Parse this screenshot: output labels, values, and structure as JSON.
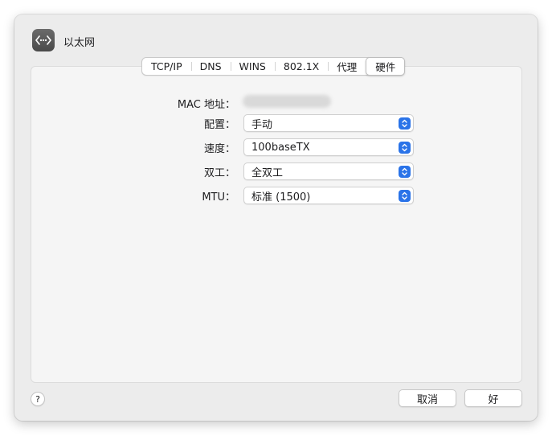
{
  "window": {
    "title": "以太网",
    "icon": "network-arrows-icon"
  },
  "tabs": [
    {
      "label": "TCP/IP",
      "selected": false
    },
    {
      "label": "DNS",
      "selected": false
    },
    {
      "label": "WINS",
      "selected": false
    },
    {
      "label": "802.1X",
      "selected": false
    },
    {
      "label": "代理",
      "selected": false
    },
    {
      "label": "硬件",
      "selected": true
    }
  ],
  "hardware": {
    "mac_label": "MAC 地址：",
    "config_label": "配置：",
    "config_value": "手动",
    "speed_label": "速度：",
    "speed_value": "100baseTX",
    "duplex_label": "双工：",
    "duplex_value": "全双工",
    "mtu_label": "MTU：",
    "mtu_value": "标准 (1500)"
  },
  "footer": {
    "help": "?",
    "cancel": "取消",
    "ok": "好"
  },
  "colors": {
    "accent": "#2a73e8",
    "window_bg": "#ececec",
    "panel_bg": "#f5f5f5"
  }
}
